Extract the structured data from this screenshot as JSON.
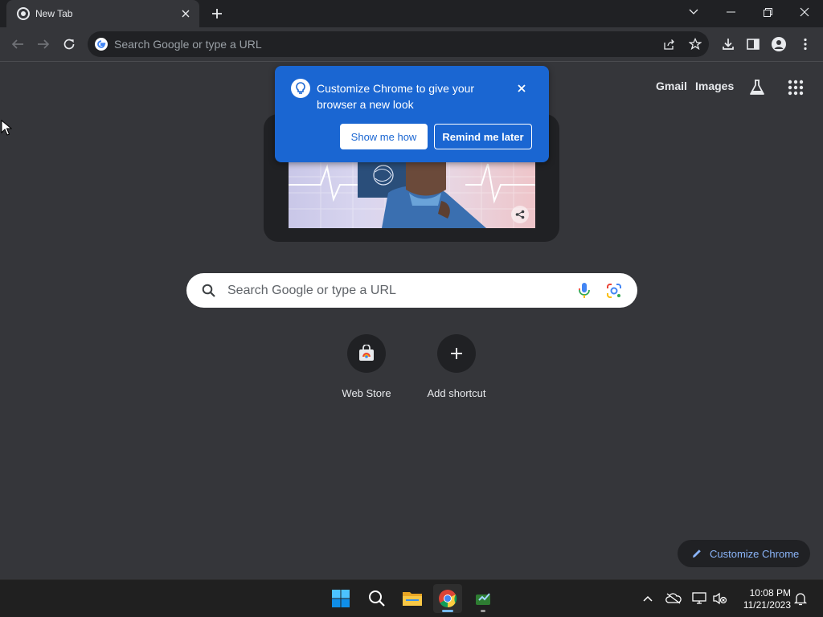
{
  "browser": {
    "tab": {
      "title": "New Tab"
    },
    "omnibox": {
      "placeholder": "Search Google or type a URL"
    }
  },
  "page": {
    "top_links": [
      "Gmail",
      "Images"
    ],
    "search": {
      "placeholder": "Search Google or type a URL"
    },
    "shortcuts": [
      {
        "label": "Web Store",
        "icon": "web-store-icon"
      },
      {
        "label": "Add shortcut",
        "icon": "plus-icon"
      }
    ],
    "customize_button": "Customize Chrome"
  },
  "promo": {
    "message": "Customize Chrome to give your browser a new look",
    "show_button": "Show me how",
    "later_button": "Remind me later"
  },
  "taskbar": {
    "time": "10:08 PM",
    "date": "11/21/2023"
  },
  "colors": {
    "page_bg": "#35363a",
    "tabstrip_bg": "#202124",
    "promo_bg": "#1a66d2",
    "accent_link": "#8ab4f8"
  }
}
